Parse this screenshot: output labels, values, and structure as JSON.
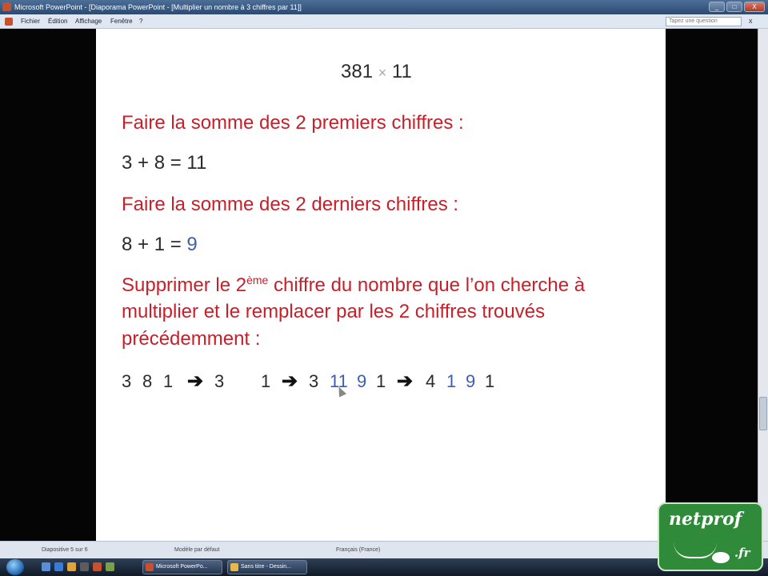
{
  "window": {
    "title": "Microsoft PowerPoint - [Diaporama PowerPoint - [Multiplier un nombre à 3 chiffres par 11]]",
    "controls": [
      "_",
      "□",
      "X"
    ]
  },
  "menubar": {
    "items": [
      "Fichier",
      "Édition",
      "Affichage",
      "Fenêtre",
      "?"
    ],
    "help_placeholder": "Tapez une question",
    "close_symbol": "x"
  },
  "slide": {
    "title_left": "381",
    "title_op": "×",
    "title_right": "11",
    "step1_heading": "Faire la somme des 2 premiers chiffres :",
    "step1_equation": "3 + 8 = 11",
    "step2_heading": "Faire la somme des 2 derniers chiffres :",
    "step2_eq_prefix": "8 + 1 = ",
    "step2_eq_result": "9",
    "step3_line1_a": "Supprimer le 2",
    "step3_line1_sup": "ème",
    "step3_line1_b": " chiffre du nombre que l’on cherche à",
    "step3_line2": "multiplier et le remplacer par les 2 chiffres trouvés",
    "step3_line3": "précédemment :",
    "sequence": {
      "g1": [
        "3",
        "8",
        "1"
      ],
      "arrow": "➔",
      "g2": [
        "3",
        "",
        "1"
      ],
      "g3": [
        "3",
        "11",
        "9",
        "1"
      ],
      "g4": [
        "4",
        "1",
        "9",
        "1"
      ]
    }
  },
  "statusbar": {
    "slide_info": "Diapositive 5 sur 6",
    "design": "Modèle par défaut",
    "language": "Français (France)"
  },
  "taskbar": {
    "tasks": [
      "Microsoft PowerPo...",
      "Sans titre - Dessin..."
    ]
  },
  "logo": {
    "name": "netprof",
    "suffix": ".fr"
  },
  "colors": {
    "heading_red": "#c8202a",
    "accent_blue": "#3b5fb0",
    "logo_green": "#2f8a3a"
  }
}
